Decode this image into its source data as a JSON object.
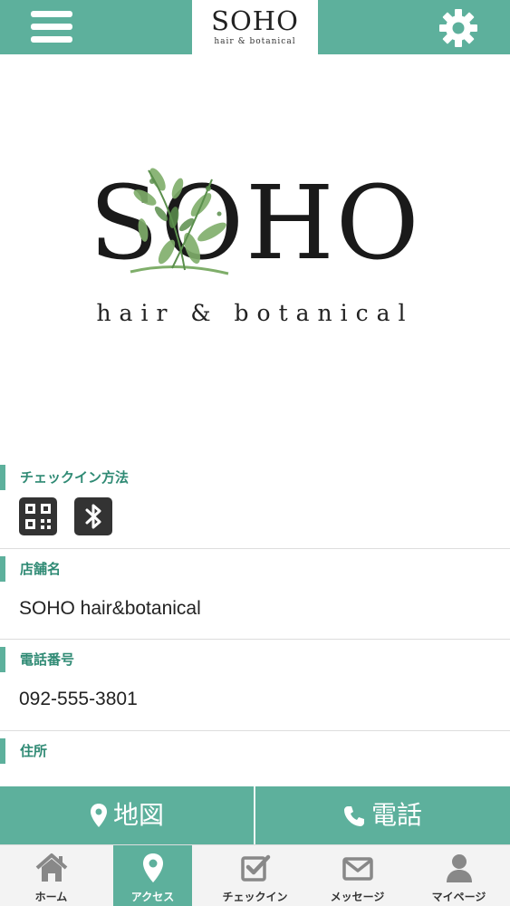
{
  "header": {
    "logo_word": "SOHO",
    "logo_sub": "hair & botanical"
  },
  "hero": {
    "logo_word": "SOHO",
    "logo_sub": "hair & botanical"
  },
  "sections": {
    "checkin": {
      "label": "チェックイン方法",
      "icons": [
        "qr-code-icon",
        "bluetooth-icon"
      ]
    },
    "shop_name": {
      "label": "店舗名",
      "value": "SOHO hair&botanical"
    },
    "phone": {
      "label": "電話番号",
      "value": "092-555-3801"
    },
    "address": {
      "label": "住所"
    }
  },
  "actions": {
    "map_label": "地図",
    "phone_label": "電話"
  },
  "tabs": [
    {
      "label": "ホーム",
      "icon": "home-icon"
    },
    {
      "label": "アクセス",
      "icon": "map-pin-icon",
      "active": true
    },
    {
      "label": "チェックイン",
      "icon": "checkin-icon"
    },
    {
      "label": "メッセージ",
      "icon": "envelope-icon"
    },
    {
      "label": "マイページ",
      "icon": "user-icon"
    }
  ],
  "colors": {
    "accent": "#5db09c",
    "accent_text": "#2f8a74",
    "tabbar_bg": "#f3f3f3"
  }
}
